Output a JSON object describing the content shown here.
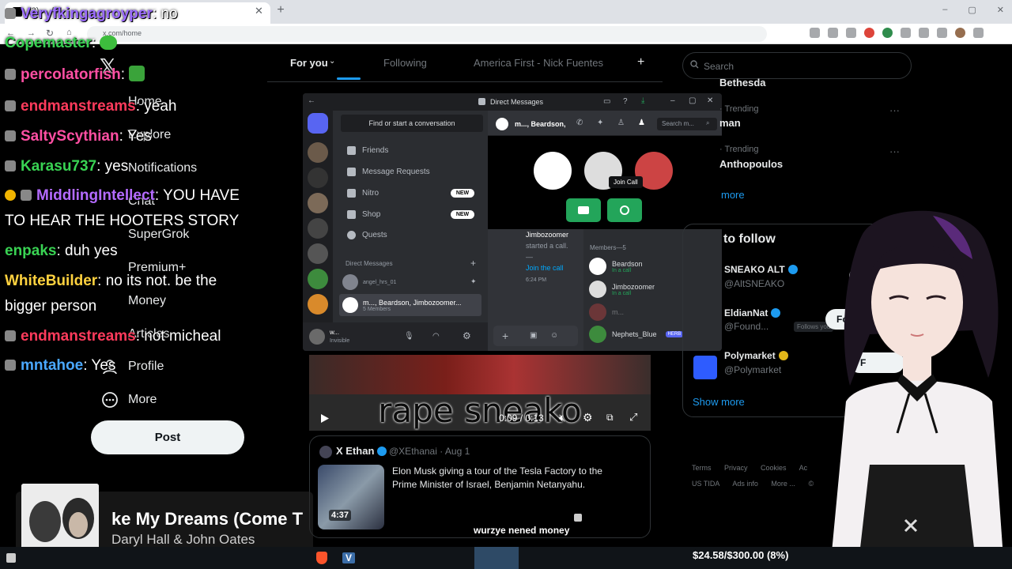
{
  "browser": {
    "tab_title": "(3) ... / X",
    "url": "x.com/home",
    "window_controls": [
      "–",
      "▢",
      "✕"
    ]
  },
  "x_nav": {
    "items": [
      "Home",
      "Explore",
      "Notifications",
      "Chat",
      "SuperGrok",
      "Premium+",
      "Money",
      "Articles",
      "Profile",
      "More"
    ],
    "post_label": "Post"
  },
  "chat": [
    {
      "user": "Veryfkingagroyper",
      "msg": ": no",
      "color": "#9b6bff"
    },
    {
      "user": "Copemaster",
      "msg": ":",
      "color": "#39d353"
    },
    {
      "user": "percolatorfish",
      "msg": ":",
      "color": "#ff4fa3"
    },
    {
      "user": "endmanstreams",
      "msg": ": yeah",
      "color": "#ff3b5c"
    },
    {
      "user": "SaltyScythian",
      "msg": ": Yes",
      "color": "#ff4fa3"
    },
    {
      "user": "Karasu737",
      "msg": ": yes",
      "color": "#39d353"
    },
    {
      "user": "MiddlingIntellect",
      "msg": ": YOU HAVE",
      "color": "#b46bff"
    },
    {
      "user": "",
      "msg": "TO HEAR THE HOOTERS STORY",
      "color": "#ffffff"
    },
    {
      "user": "enpaks",
      "msg": ": duh yes",
      "color": "#39d353"
    },
    {
      "user": "WhiteBuilder",
      "msg": ": no its not. be the",
      "color": "#ffd23f"
    },
    {
      "user": "",
      "msg": "bigger person",
      "color": "#ffffff"
    },
    {
      "user": "endmanstreams",
      "msg": ": not micheal",
      "color": "#ff3b5c"
    },
    {
      "user": "mntahoe",
      "msg": ": Yes",
      "color": "#4aa8ff"
    }
  ],
  "x_tabs": {
    "for_you": "For you",
    "following": "Following",
    "community": "America First - Nick Fuentes",
    "plus": "+"
  },
  "discord": {
    "title": "Direct Messages",
    "find_conversation": "Find or start a conversation",
    "menu": [
      {
        "label": "Friends",
        "badge": ""
      },
      {
        "label": "Message Requests",
        "badge": ""
      },
      {
        "label": "Nitro",
        "badge": "NEW"
      },
      {
        "label": "Shop",
        "badge": "NEW"
      },
      {
        "label": "Quests",
        "badge": ""
      }
    ],
    "dm_heading": "Direct Messages",
    "dm_plus": "+",
    "dms": [
      {
        "name": "angel_hrs_01",
        "sub": ""
      },
      {
        "name": "m..., Beardson, Jimbozoomer...",
        "sub": "5 Members"
      }
    ],
    "user_name": "w...",
    "user_status": "Invisible",
    "group_title": "m..., Beardson,",
    "search_placeholder": "Search m...",
    "join_call_tooltip": "Join Call",
    "system_msg": {
      "name": "Jimbozoomer",
      "text": "started a call. —",
      "link": "Join the call",
      "time": "6:24 PM"
    },
    "members_heading": "Members—5",
    "members": [
      {
        "name": "Beardson",
        "sub": "In a call",
        "tag": ""
      },
      {
        "name": "Jimbozoomer",
        "sub": "In a call",
        "tag": ""
      },
      {
        "name": "m...",
        "sub": "",
        "tag": ""
      },
      {
        "name": "Nephets_Blue",
        "sub": "",
        "tag": "HERB"
      }
    ]
  },
  "video": {
    "caption": "rape sneako",
    "time": "0:09 / 0:13"
  },
  "tweet": {
    "name": "X Ethan",
    "handle": "@XEthanai · Aug 1",
    "duration": "4:37",
    "text": "Elon Musk giving a tour of the Tesla Factory to the Prime Minister of Israel, Benjamin Netanyahu.",
    "overlay": "wurzye nened money"
  },
  "right": {
    "search_placeholder": "Search",
    "trends": [
      {
        "meta": "",
        "name": "Bethesda"
      },
      {
        "meta": "· Trending",
        "name": "man"
      },
      {
        "meta": "· Trending",
        "name": "Anthopoulos"
      }
    ],
    "show_more_1": "more",
    "wtf_title": "to follow",
    "accounts": [
      {
        "name": "SNEAKO ALT",
        "handle": "@AltSNEAKO",
        "follows_you": "",
        "button": "F"
      },
      {
        "name": "EldianNat",
        "handle": "@Found...",
        "follows_you": "Follows you",
        "button": "Foll"
      },
      {
        "name": "Polymarket",
        "handle": "@Polymarket",
        "follows_you": "",
        "button": "F"
      }
    ],
    "show_more_2": "Show more",
    "footer": [
      "Terms",
      "Privacy",
      "Cookies",
      "Ac",
      "US TIDA",
      "Ads info",
      "More ...",
      "©"
    ]
  },
  "now_playing": {
    "title": "ke My Dreams (Come T",
    "artist": "Daryl Hall & John Oates"
  },
  "taskbar": {
    "goal": "$24.58/$300.00 (8%)"
  }
}
